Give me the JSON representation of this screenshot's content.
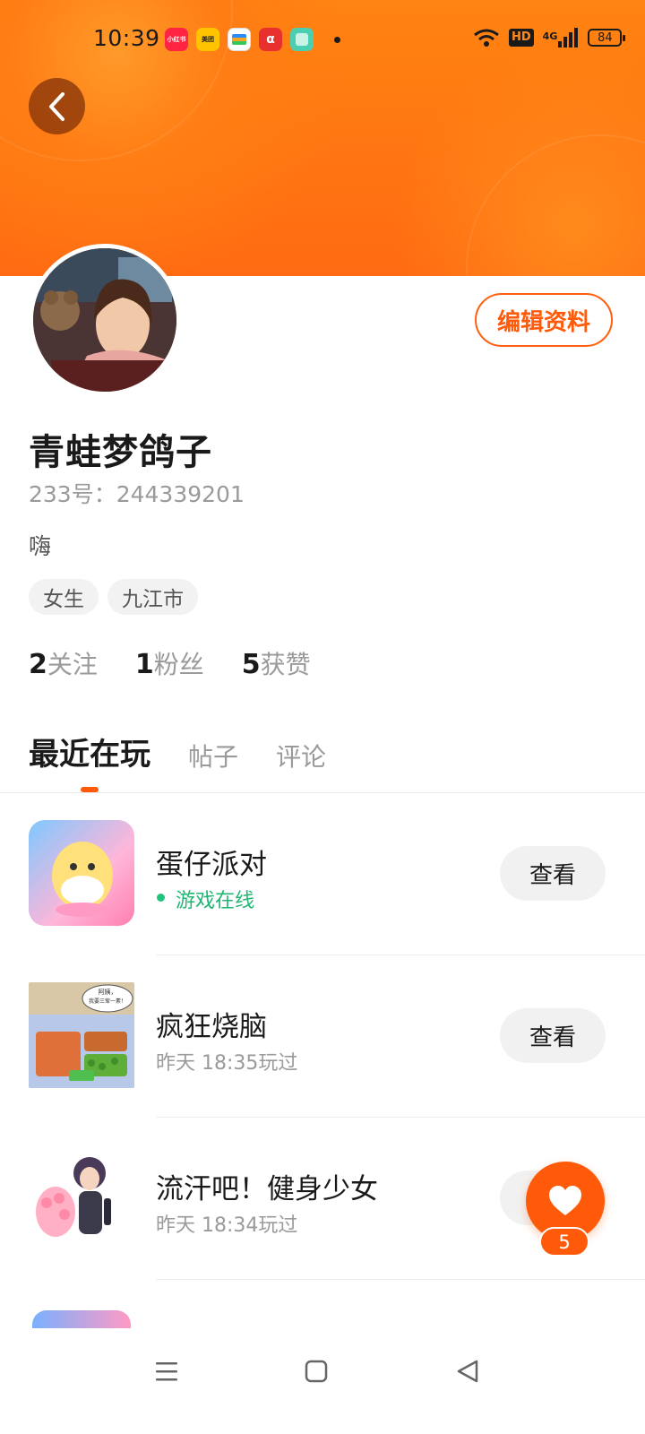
{
  "status_bar": {
    "time": "10:39",
    "apps": [
      {
        "name": "xiaohongshu",
        "label": "小红书",
        "color": "#ff2442"
      },
      {
        "name": "meituan",
        "label": "美团",
        "color": "#ffc300"
      },
      {
        "name": "wallet",
        "label": "",
        "color": "#f5a623"
      },
      {
        "name": "red-app",
        "label": "",
        "color": "#e8312f"
      },
      {
        "name": "green-app",
        "label": "",
        "color": "#4ccfb0"
      }
    ],
    "network": "4G",
    "hd": "HD",
    "battery": "84"
  },
  "profile": {
    "username": "青蛙梦鸽子",
    "user_id": "233号：244339201",
    "bio": "嗨",
    "tags": [
      "女生",
      "九江市"
    ],
    "edit_button": "编辑资料",
    "stats": [
      {
        "num": "2",
        "label": "关注"
      },
      {
        "num": "1",
        "label": "粉丝"
      },
      {
        "num": "5",
        "label": "获赞"
      }
    ]
  },
  "tabs": [
    {
      "label": "最近在玩",
      "active": true
    },
    {
      "label": "帖子",
      "active": false
    },
    {
      "label": "评论",
      "active": false
    }
  ],
  "games": [
    {
      "title": "蛋仔派对",
      "subtitle": "游戏在线",
      "online": true,
      "button": "查看"
    },
    {
      "title": "疯狂烧脑",
      "subtitle": "昨天 18:35玩过",
      "online": false,
      "button": "查看"
    },
    {
      "title": "流汗吧！健身少女",
      "subtitle": "昨天 18:34玩过",
      "online": false,
      "button": "查看"
    }
  ],
  "game_icon_texts": {
    "crazy_brain_bubble": "阿姨，我要三荤一素！"
  },
  "like_fab": {
    "count": "5"
  },
  "colors": {
    "accent": "#ff5a0a",
    "header": "#ff7a12",
    "online": "#22b573"
  }
}
